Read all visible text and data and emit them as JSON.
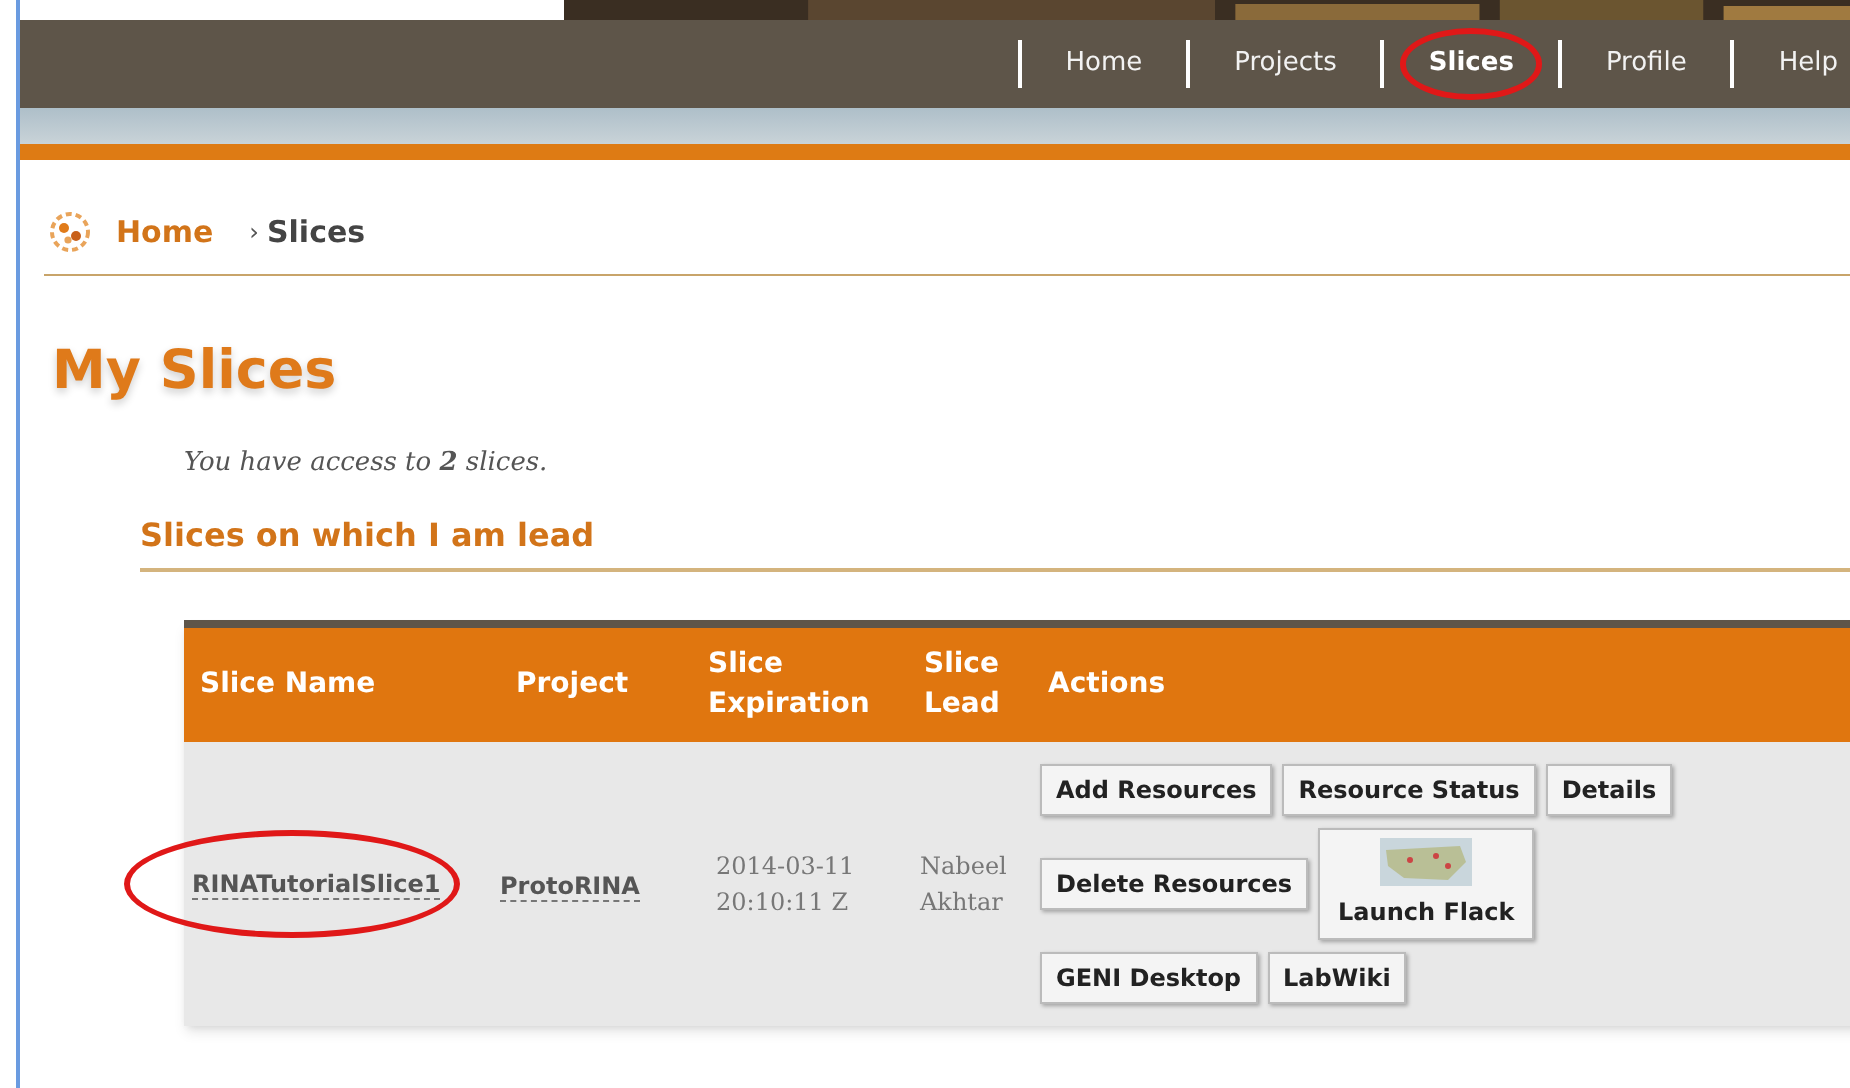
{
  "nav": [
    {
      "label": "Home",
      "selected": false,
      "circled": false
    },
    {
      "label": "Projects",
      "selected": false,
      "circled": false
    },
    {
      "label": "Slices",
      "selected": true,
      "circled": true
    },
    {
      "label": "Profile",
      "selected": false,
      "circled": false
    },
    {
      "label": "Help",
      "selected": false,
      "circled": false
    }
  ],
  "breadcrumb": {
    "home": "Home",
    "separator": "›",
    "current": "Slices"
  },
  "title": "My Slices",
  "access_text": "You have access to **2** slices.",
  "section_title": "Slices on which I am lead",
  "table": {
    "columns": [
      "Slice Name",
      "Project",
      "Slice\nExpiration",
      "Slice\nLead",
      "Actions"
    ],
    "rows": [
      {
        "slice_name": "RINATutorialSlice1",
        "circled": true,
        "project": "ProtoRINA",
        "expiration": "2014-03-11\n20:10:11 Z",
        "lead": "Nabeel\nAkhtar",
        "actions": [
          [
            {
              "label": "Add Resources",
              "kind": "text"
            },
            {
              "label": "Resource Status",
              "kind": "text"
            },
            {
              "label": "Details",
              "kind": "text"
            }
          ],
          [
            {
              "label": "Delete Resources",
              "kind": "text"
            },
            {
              "label": "Launch Flack",
              "kind": "map"
            }
          ],
          [
            {
              "label": "GENI Desktop",
              "kind": "text"
            },
            {
              "label": "LabWiki",
              "kind": "text"
            }
          ]
        ]
      }
    ]
  }
}
